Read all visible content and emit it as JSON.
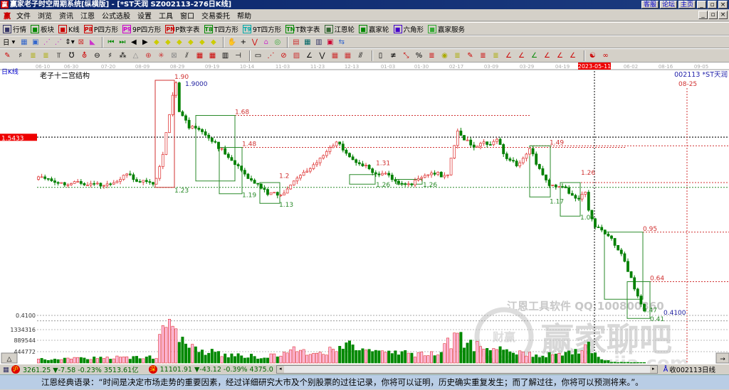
{
  "window": {
    "title": "赢家老子时空周期系统[纵横版] - [*ST天润   SZ002113-276日K线]",
    "logo": "赢",
    "links": [
      "客服",
      "论坛",
      "主页"
    ],
    "controls": [
      "_",
      "▫",
      "×"
    ]
  },
  "menu": {
    "logo": "赢",
    "items": [
      "文件",
      "浏览",
      "资讯",
      "江恩",
      "公式选股",
      "设置",
      "工具",
      "窗口",
      "交易委托",
      "帮助"
    ]
  },
  "toolbar1": [
    {
      "icon": "grid-icon",
      "label": "行情",
      "color": "#336"
    },
    {
      "icon": "blocks-icon",
      "label": "板块",
      "color": "#080"
    },
    {
      "icon": "kline-icon",
      "label": "K线",
      "color": "#c00"
    },
    {
      "icon": "P8",
      "label": "P四方形",
      "color": "#c00"
    },
    {
      "icon": "P9",
      "label": "9P四方形",
      "color": "#c0c"
    },
    {
      "icon": "PN",
      "label": "P数字表",
      "color": "#c00"
    },
    {
      "icon": "T8",
      "label": "T四方形",
      "color": "#080"
    },
    {
      "icon": "T9",
      "label": "9T四方形",
      "color": "#0aa"
    },
    {
      "icon": "TN",
      "label": "T数字表",
      "color": "#080"
    },
    {
      "icon": "wheel-icon",
      "label": "江恩轮",
      "color": "#363"
    },
    {
      "icon": "wheel2-icon",
      "label": "赢家轮",
      "color": "#080"
    },
    {
      "icon": "hexagon-icon",
      "label": "六角形",
      "color": "#40c"
    },
    {
      "icon": "dollar-icon",
      "label": "赢家服务",
      "color": "#3a3"
    }
  ],
  "toolbar2": {
    "period": "日"
  },
  "date_axis": [
    "06-10",
    "06-30",
    "07-20",
    "08-09",
    "08-29",
    "09-19",
    "10-14",
    "11-03",
    "11-23",
    "12-13",
    "01-03",
    "01-30",
    "02-17",
    "03-09",
    "03-29",
    "04-19",
    "2023-05-11",
    "06-02",
    "08-16",
    "09-05"
  ],
  "chart": {
    "period_label": "日K线",
    "study_title": "老子十二宫结构",
    "symbol": "002113 *ST天润",
    "cursor_price": "1.5433",
    "future_date": "08-25",
    "watermark1": "江恩工具软件  QQ:100800360",
    "watermark2": "赢家聊吧",
    "watermark3": "jiaoba.yingjia.com",
    "watermark_logo": "财赢",
    "colors": {
      "up": "#e04040",
      "down": "#008000",
      "annot_red": "#d03030",
      "annot_green": "#2a8a2a",
      "annot_blue": "#2020a0"
    }
  },
  "chart_data": {
    "type": "candlestick",
    "price_path": [
      [
        0,
        1.28
      ],
      [
        6,
        1.27
      ],
      [
        15,
        1.24
      ],
      [
        21,
        1.26
      ],
      [
        27,
        1.31
      ],
      [
        30,
        1.25
      ],
      [
        35,
        1.27
      ],
      [
        36,
        1.3
      ],
      [
        38,
        1.45
      ],
      [
        40,
        1.7
      ],
      [
        42,
        1.88
      ],
      [
        43,
        1.7
      ],
      [
        46,
        1.6
      ],
      [
        48,
        1.62
      ],
      [
        52,
        1.55
      ],
      [
        54,
        1.52
      ],
      [
        58,
        1.4
      ],
      [
        63,
        1.32
      ],
      [
        66,
        1.27
      ],
      [
        70,
        1.2
      ],
      [
        73,
        1.17
      ],
      [
        76,
        1.2
      ],
      [
        78,
        1.27
      ],
      [
        82,
        1.35
      ],
      [
        86,
        1.4
      ],
      [
        91,
        1.5
      ],
      [
        94,
        1.45
      ],
      [
        97,
        1.4
      ],
      [
        100,
        1.35
      ],
      [
        103,
        1.3
      ],
      [
        106,
        1.3
      ],
      [
        110,
        1.27
      ],
      [
        115,
        1.26
      ],
      [
        119,
        1.3
      ],
      [
        125,
        1.32
      ],
      [
        128,
        1.6
      ],
      [
        130,
        1.52
      ],
      [
        133,
        1.48
      ],
      [
        137,
        1.5
      ],
      [
        140,
        1.55
      ],
      [
        142,
        1.45
      ],
      [
        146,
        1.35
      ],
      [
        148,
        1.4
      ],
      [
        150,
        1.46
      ],
      [
        153,
        1.36
      ],
      [
        156,
        1.25
      ],
      [
        159,
        1.25
      ],
      [
        163,
        1.17
      ],
      [
        165,
        1.15
      ],
      [
        167,
        1.22
      ],
      [
        168,
        1.1
      ],
      [
        170,
        1.0
      ],
      [
        172,
        0.98
      ],
      [
        174,
        0.93
      ],
      [
        178,
        0.8
      ],
      [
        181,
        0.65
      ],
      [
        184,
        0.5
      ],
      [
        185,
        0.47
      ]
    ],
    "volume_path": [
      [
        0,
        150000
      ],
      [
        20,
        200000
      ],
      [
        36,
        250000
      ],
      [
        38,
        1500000
      ],
      [
        40,
        1800000
      ],
      [
        42,
        1100000
      ],
      [
        45,
        700000
      ],
      [
        50,
        500000
      ],
      [
        60,
        300000
      ],
      [
        70,
        250000
      ],
      [
        78,
        500000
      ],
      [
        85,
        350000
      ],
      [
        95,
        700000
      ],
      [
        100,
        450000
      ],
      [
        110,
        400000
      ],
      [
        120,
        350000
      ],
      [
        128,
        1000000
      ],
      [
        135,
        600000
      ],
      [
        150,
        350000
      ],
      [
        160,
        300000
      ],
      [
        168,
        700000
      ],
      [
        170,
        350000
      ],
      [
        175,
        30000
      ],
      [
        185,
        30000
      ]
    ],
    "volume_ticks": [
      "444772",
      "889544",
      "1334316"
    ],
    "volume_top_label": "0.4100",
    "annotations": [
      {
        "text": "1.90",
        "price": 1.9,
        "color": "red"
      },
      {
        "text": "1.9000",
        "price": 1.855,
        "color": "blue"
      },
      {
        "text": "1.68",
        "price": 1.68,
        "color": "red"
      },
      {
        "text": "1.48",
        "price": 1.48,
        "color": "red"
      },
      {
        "text": "1.23",
        "price": 1.19,
        "color": "green"
      },
      {
        "text": "1.19",
        "price": 1.16,
        "color": "green"
      },
      {
        "text": "1.13",
        "price": 1.1,
        "color": "green"
      },
      {
        "text": "1.2",
        "price": 1.28,
        "color": "red"
      },
      {
        "text": "1.31",
        "price": 1.36,
        "color": "red"
      },
      {
        "text": "1.26",
        "price": 1.225,
        "color": "green"
      },
      {
        "text": "1.26",
        "price": 1.225,
        "color": "green"
      },
      {
        "text": "1.49",
        "price": 1.49,
        "color": "red"
      },
      {
        "text": "1.26",
        "price": 1.3,
        "color": "red"
      },
      {
        "text": "1.17",
        "price": 1.12,
        "color": "green"
      },
      {
        "text": "1.05",
        "price": 1.02,
        "color": "green"
      },
      {
        "text": "0.95",
        "price": 0.95,
        "color": "red"
      },
      {
        "text": "0.64",
        "price": 0.64,
        "color": "red"
      },
      {
        "text": "0.47",
        "price": 0.44,
        "color": "green"
      },
      {
        "text": "0.41",
        "price": 0.385,
        "color": "green"
      },
      {
        "text": "0.4100",
        "price": 0.425,
        "color": "blue"
      }
    ]
  },
  "status": {
    "sh_badge": "沪",
    "sh_text": "3261.25 ▼-7.58 -0.23% 3513.61亿",
    "sz_badge": "深",
    "sz_text": "11101.91 ▼-43.12 -0.39% 4375.0",
    "right_text": "收002113日线"
  },
  "quote": "江恩经典语录：“时间是决定市场走势的重要因素，经过详细研究大市及个别股票的过往记录，你将可以证明，历史确实重复发生；而了解过往，你将可以预测将来。”。"
}
